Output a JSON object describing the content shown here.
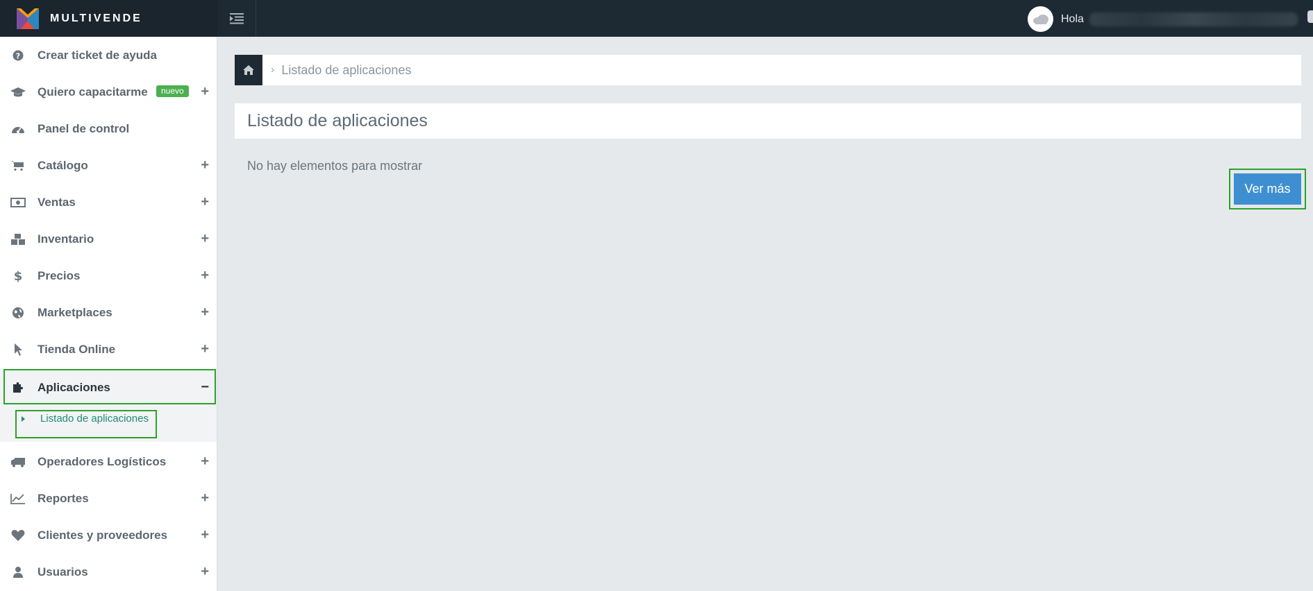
{
  "app": {
    "brand": "MULTIVENDE",
    "greeting": "Hola"
  },
  "sidebar": {
    "items": [
      {
        "label": "Crear ticket de ayuda",
        "icon": "question-circle-icon",
        "expandable": false
      },
      {
        "label": "Quiero capacitarme",
        "icon": "graduation-cap-icon",
        "expandable": true,
        "badge": "nuevo"
      },
      {
        "label": "Panel de control",
        "icon": "dashboard-icon",
        "expandable": false
      },
      {
        "label": "Catálogo",
        "icon": "shopping-cart-icon",
        "expandable": true
      },
      {
        "label": "Ventas",
        "icon": "money-icon",
        "expandable": true
      },
      {
        "label": "Inventario",
        "icon": "cubes-icon",
        "expandable": true
      },
      {
        "label": "Precios",
        "icon": "dollar-icon",
        "expandable": true
      },
      {
        "label": "Marketplaces",
        "icon": "globe-icon",
        "expandable": true
      },
      {
        "label": "Tienda Online",
        "icon": "mouse-pointer-icon",
        "expandable": true
      },
      {
        "label": "Aplicaciones",
        "icon": "puzzle-piece-icon",
        "expandable": true,
        "expanded": true
      },
      {
        "label": "Operadores Logísticos",
        "icon": "truck-icon",
        "expandable": true
      },
      {
        "label": "Reportes",
        "icon": "line-chart-icon",
        "expandable": true
      },
      {
        "label": "Clientes y proveedores",
        "icon": "heart-icon",
        "expandable": true
      },
      {
        "label": "Usuarios",
        "icon": "user-icon",
        "expandable": true
      }
    ],
    "expand_symbol": "+",
    "collapse_symbol": "−",
    "submenu": {
      "label": "Listado de aplicaciones"
    }
  },
  "breadcrumb": {
    "separator": "›",
    "current": "Listado de aplicaciones"
  },
  "main": {
    "title": "Listado de aplicaciones",
    "empty_message": "No hay elementos para mostrar",
    "ver_mas_label": "Ver más"
  },
  "colors": {
    "topbar": "#1e2a33",
    "accent_green": "#29a329",
    "submenu_text": "#1f8a79",
    "button_blue": "#3d8fd1",
    "badge_green": "#4caf50"
  }
}
